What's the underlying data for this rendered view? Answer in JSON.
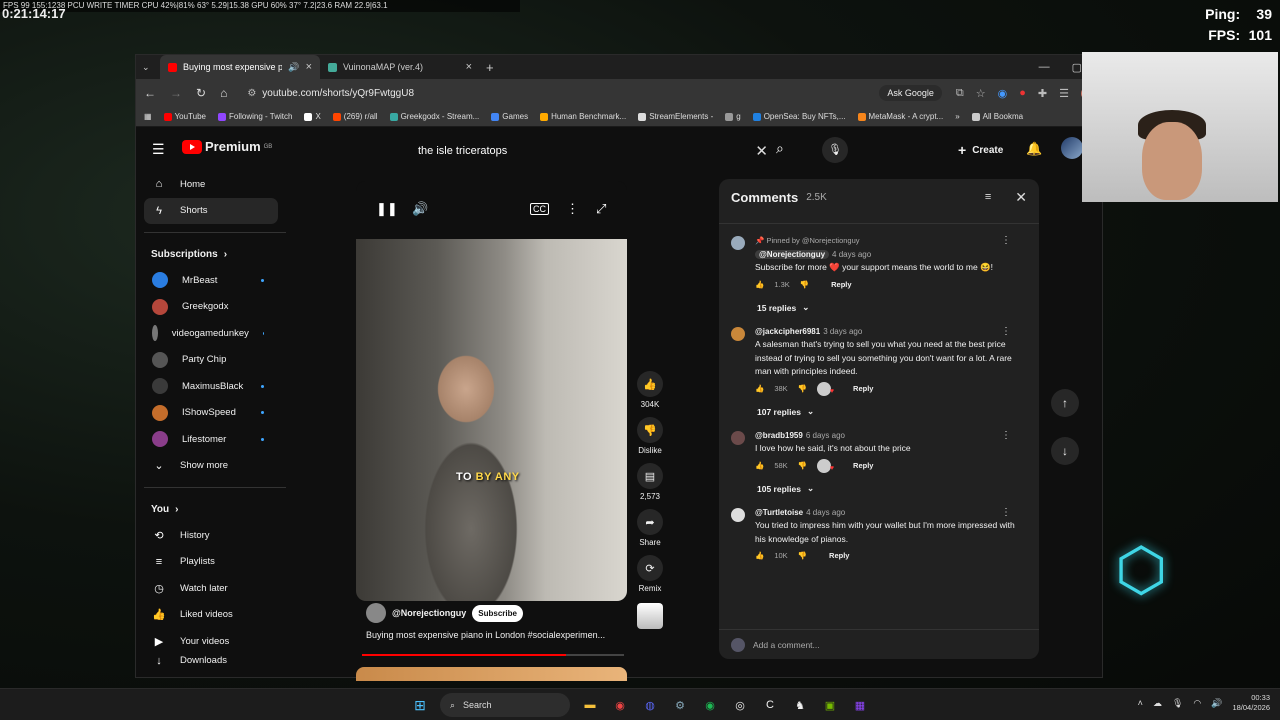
{
  "overlay": {
    "stats_line": "FPS 99 155:1238  PCU WRITE TIMER  CPU 42%|81%  63° 5.29|15.38 GPU 60% 37° 7.2|23.6  RAM 22.9|63.1",
    "timer": "0:21:14:17",
    "ping_label": "Ping:",
    "ping_value": "39",
    "fps_label": "FPS:",
    "fps_value": "101"
  },
  "browser": {
    "tabs": [
      {
        "title": "Buying most expensive pia"
      },
      {
        "title": "VuinonaMAP (ver.4)"
      }
    ],
    "url": "youtube.com/shorts/yQr9FwtggU8",
    "ask_google": "Ask Google",
    "bookmarks": [
      "YouTube",
      "Following - Twitch",
      "X",
      "(269) r/all",
      "Greekgodx - Stream...",
      "Games",
      "Human Benchmark...",
      "StreamElements -",
      "g",
      "OpenSea: Buy NFTs,...",
      "MetaMask - A crypt...",
      "All Bookma"
    ],
    "bookmark_colors": [
      "#ff0000",
      "#9146ff",
      "#ffffff",
      "#ff4500",
      "#38a9a3",
      "#4285f4",
      "#ffaa00",
      "#dddddd",
      "#999999",
      "#2081e2",
      "#f6851b",
      "#cccccc"
    ]
  },
  "youtube": {
    "logo_text": "Premium",
    "logo_sup": "GB",
    "search_value": "the isle triceratops",
    "create_label": "Create",
    "sidebar": {
      "home": "Home",
      "shorts": "Shorts",
      "subscriptions_header": "Subscriptions",
      "subs": [
        {
          "name": "MrBeast",
          "color": "#2a7de1",
          "dot": true
        },
        {
          "name": "Greekgodx",
          "color": "#b5473b",
          "dot": false
        },
        {
          "name": "videogamedunkey",
          "color": "#777777",
          "dot": true
        },
        {
          "name": "Party Chip",
          "color": "#555555",
          "dot": false
        },
        {
          "name": "MaximusBlack",
          "color": "#3a3a3a",
          "dot": true
        },
        {
          "name": "IShowSpeed",
          "color": "#c46d2b",
          "dot": true
        },
        {
          "name": "Lifestomer",
          "color": "#8a3d8a",
          "dot": true
        }
      ],
      "show_more": "Show more",
      "you_header": "You",
      "you_items": [
        "History",
        "Playlists",
        "Watch later",
        "Liked videos",
        "Your videos",
        "Downloads"
      ]
    },
    "video": {
      "caption_white": "TO",
      "caption_yellow": "BY ANY",
      "channel": "@Norejectionguy",
      "subscribe": "Subscribe",
      "title": "Buying most expensive piano in London #socialexperimen...",
      "progress": 0.78
    },
    "actions": {
      "likes": "304K",
      "dislike": "Dislike",
      "comments": "2,573",
      "share": "Share",
      "remix": "Remix"
    },
    "comments": {
      "title": "Comments",
      "count": "2.5K",
      "items": [
        {
          "pinned": "Pinned by @Norejectionguy",
          "user": "@Norejectionguy",
          "time": "4 days ago",
          "text": "Subscribe for more ❤️ your support means the world to me 😆!",
          "likes": "1.3K",
          "replies": "15 replies",
          "avatar": "#9ab",
          "hearted": false
        },
        {
          "user": "@jackcipher6981",
          "time": "3 days ago",
          "text": "A salesman that's trying to sell you what you need at the best price instead of trying to sell you something you don't want for a lot. A rare man with principles indeed.",
          "likes": "38K",
          "replies": "107 replies",
          "avatar": "#c8873a",
          "hearted": true
        },
        {
          "user": "@bradb1959",
          "time": "6 days ago",
          "text": "I love how he said, it's not about the price",
          "likes": "58K",
          "replies": "105 replies",
          "avatar": "#6b4a4a",
          "hearted": true
        },
        {
          "user": "@Turtletoise",
          "time": "4 days ago",
          "text": "You tried to impress him with your wallet but I'm more impressed with his knowledge of pianos.",
          "likes": "10K",
          "replies": "",
          "avatar": "#dddddd",
          "hearted": false
        }
      ],
      "reply_label": "Reply",
      "add_placeholder": "Add a comment..."
    }
  },
  "taskbar": {
    "search": "Search",
    "time": "00:33",
    "date": "18/04/2026"
  }
}
